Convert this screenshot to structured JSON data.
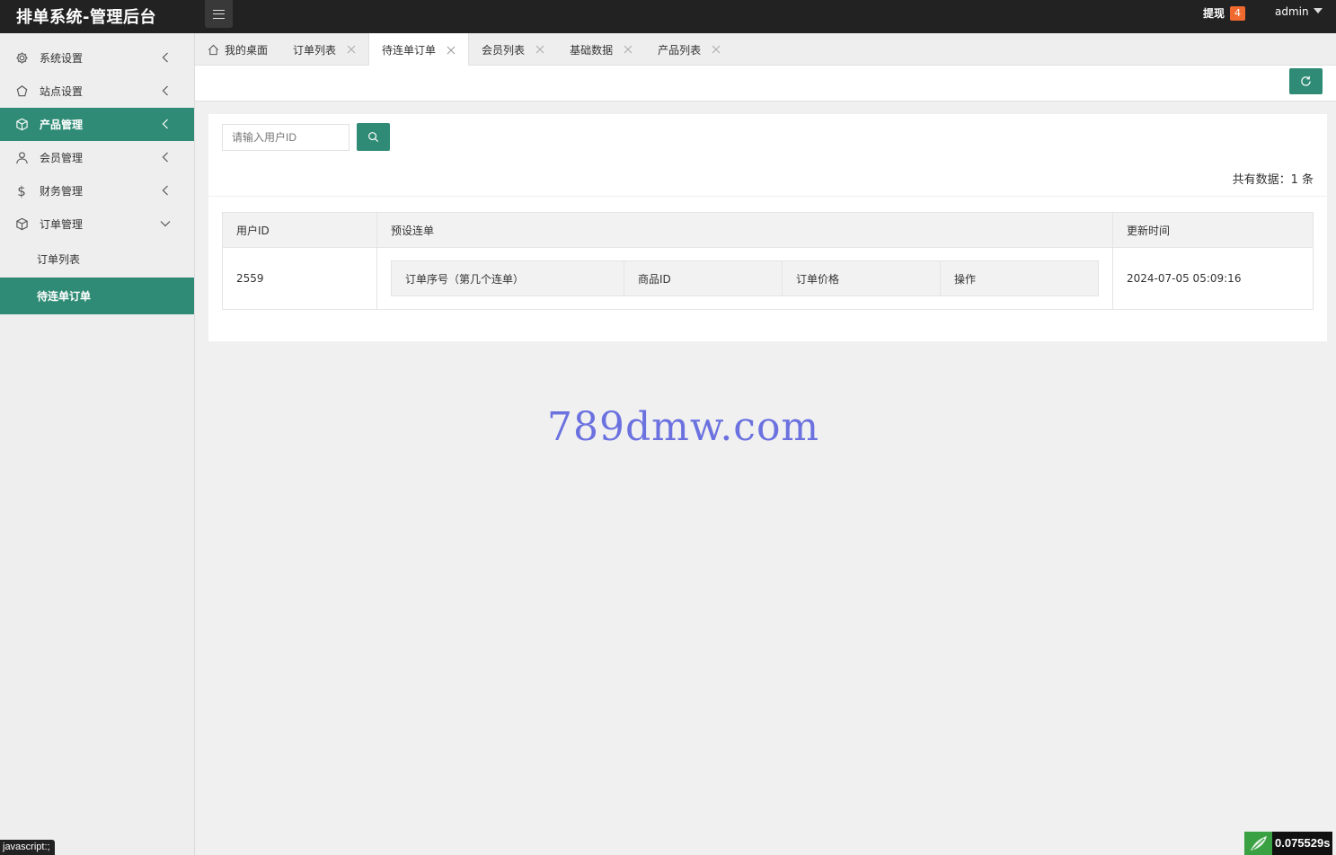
{
  "header": {
    "title": "排单系统-管理后台",
    "withdraw_label": "提现",
    "withdraw_count": "4",
    "user": "admin"
  },
  "sidebar": {
    "items": [
      {
        "label": "系统设置",
        "icon": "gear-icon"
      },
      {
        "label": "站点设置",
        "icon": "site-icon"
      },
      {
        "label": "产品管理",
        "icon": "cube-icon"
      },
      {
        "label": "会员管理",
        "icon": "user-icon"
      },
      {
        "label": "财务管理",
        "icon": "dollar-icon"
      },
      {
        "label": "订单管理",
        "icon": "cube-icon"
      }
    ],
    "sub_items": [
      {
        "label": "订单列表"
      },
      {
        "label": "待连单订单"
      }
    ]
  },
  "tabs": [
    {
      "label": "我的桌面"
    },
    {
      "label": "订单列表"
    },
    {
      "label": "待连单订单"
    },
    {
      "label": "会员列表"
    },
    {
      "label": "基础数据"
    },
    {
      "label": "产品列表"
    }
  ],
  "search": {
    "placeholder": "请输入用户ID"
  },
  "total_text": "共有数据：1 条",
  "table": {
    "headers": [
      "用户ID",
      "预设连单",
      "更新时间"
    ],
    "inner_headers": [
      "订单序号（第几个连单）",
      "商品ID",
      "订单价格",
      "操作"
    ],
    "rows": [
      {
        "user_id": "2559",
        "updated": "2024-07-05 05:09:16"
      }
    ]
  },
  "watermark": "789dmw.com",
  "status_link": "javascript:;",
  "timing": "0.075529s",
  "colors": {
    "accent": "#2f8b75",
    "header_bg": "#222222",
    "badge": "#f0692f"
  }
}
